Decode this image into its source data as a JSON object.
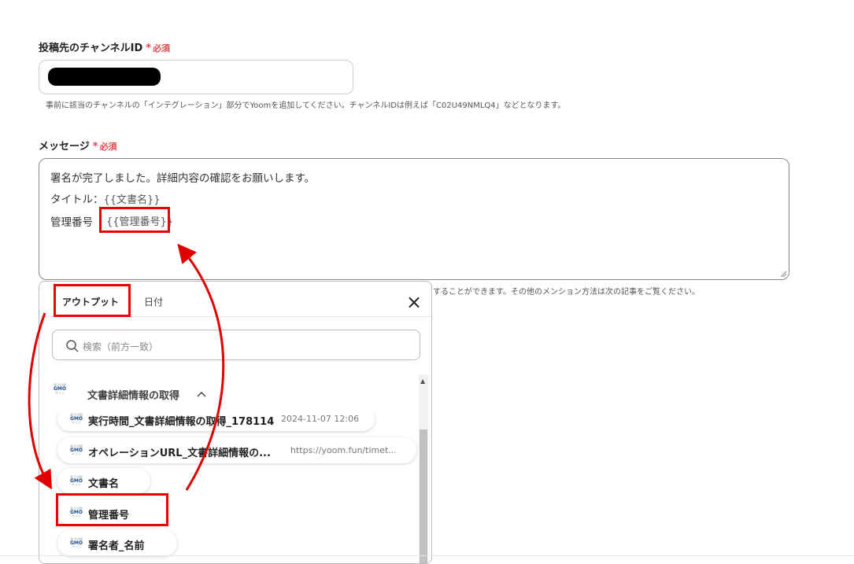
{
  "channel_field": {
    "label": "投稿先のチャンネルID",
    "required_star": "*",
    "required_text": "必須",
    "hint": "事前に該当のチャンネルの「インテグレーション」部分でYoomを追加してください。チャンネルIDは例えば「C02U49NMLQ4」などとなります。"
  },
  "message_field": {
    "label": "メッセージ",
    "required_star": "*",
    "required_text": "必須",
    "line1": "署名が完了しました。詳細内容の確認をお願いします。",
    "line2_label": "タイトル：",
    "line2_var": "{{文書名}}",
    "line3_label": "管理番号",
    "line3_var": "{{管理番号}}",
    "hint_partial": "することができます。その他のメンション方法は次の記事をご覧ください。"
  },
  "picker": {
    "tabs": [
      "アウトプット",
      "日付"
    ],
    "close_icon": "×",
    "search_placeholder": "検索（前方一致）",
    "group": {
      "logo_top": "電子印鑑",
      "logo_main": "GMO",
      "logo_bottom": "サイン",
      "title": "文書詳細情報の取得",
      "chevron": "^"
    },
    "items": [
      {
        "label": "実行時間_文書詳細情報の取得_178114",
        "value": "2024-11-07 12:06"
      },
      {
        "label": "オペレーションURL_文書詳細情報の...",
        "value": "https://yoom.fun/timet..."
      },
      {
        "label": "文書名",
        "value": ""
      },
      {
        "label": "管理番号",
        "value": ""
      },
      {
        "label": "署名者_名前",
        "value": ""
      }
    ],
    "scroll_up": "▲"
  },
  "colors": {
    "required": "#e5484d",
    "highlight": "#e00000",
    "arrow": "#e00000"
  }
}
